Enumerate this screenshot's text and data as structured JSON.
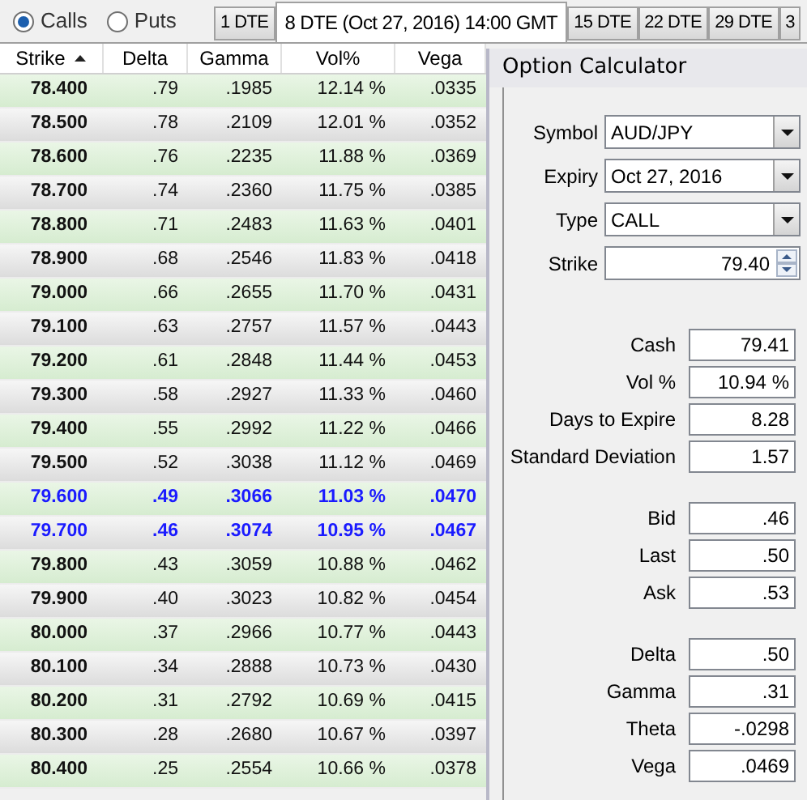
{
  "option_type": [
    {
      "label": "Calls",
      "selected": true
    },
    {
      "label": "Puts",
      "selected": false
    }
  ],
  "tabs": [
    {
      "label": "1 DTE",
      "selected": false
    },
    {
      "label": "8 DTE (Oct 27, 2016) 14:00 GMT",
      "selected": true
    },
    {
      "label": "15 DTE",
      "selected": false
    },
    {
      "label": "22 DTE",
      "selected": false
    },
    {
      "label": "29 DTE",
      "selected": false
    },
    {
      "label": "3",
      "selected": false
    }
  ],
  "table": {
    "columns": [
      "Strike",
      "Delta",
      "Gamma",
      "Vol%",
      "Vega"
    ],
    "rows": [
      {
        "cells": [
          "78.400",
          ".79",
          ".1985",
          "12.14 %",
          ".0335"
        ],
        "highlighted": false
      },
      {
        "cells": [
          "78.500",
          ".78",
          ".2109",
          "12.01 %",
          ".0352"
        ],
        "highlighted": false
      },
      {
        "cells": [
          "78.600",
          ".76",
          ".2235",
          "11.88 %",
          ".0369"
        ],
        "highlighted": false
      },
      {
        "cells": [
          "78.700",
          ".74",
          ".2360",
          "11.75 %",
          ".0385"
        ],
        "highlighted": false
      },
      {
        "cells": [
          "78.800",
          ".71",
          ".2483",
          "11.63 %",
          ".0401"
        ],
        "highlighted": false
      },
      {
        "cells": [
          "78.900",
          ".68",
          ".2546",
          "11.83 %",
          ".0418"
        ],
        "highlighted": false
      },
      {
        "cells": [
          "79.000",
          ".66",
          ".2655",
          "11.70 %",
          ".0431"
        ],
        "highlighted": false
      },
      {
        "cells": [
          "79.100",
          ".63",
          ".2757",
          "11.57 %",
          ".0443"
        ],
        "highlighted": false
      },
      {
        "cells": [
          "79.200",
          ".61",
          ".2848",
          "11.44 %",
          ".0453"
        ],
        "highlighted": false
      },
      {
        "cells": [
          "79.300",
          ".58",
          ".2927",
          "11.33 %",
          ".0460"
        ],
        "highlighted": false
      },
      {
        "cells": [
          "79.400",
          ".55",
          ".2992",
          "11.22 %",
          ".0466"
        ],
        "highlighted": false
      },
      {
        "cells": [
          "79.500",
          ".52",
          ".3038",
          "11.12 %",
          ".0469"
        ],
        "highlighted": false
      },
      {
        "cells": [
          "79.600",
          ".49",
          ".3066",
          "11.03 %",
          ".0470"
        ],
        "highlighted": true
      },
      {
        "cells": [
          "79.700",
          ".46",
          ".3074",
          "10.95 %",
          ".0467"
        ],
        "highlighted": true
      },
      {
        "cells": [
          "79.800",
          ".43",
          ".3059",
          "10.88 %",
          ".0462"
        ],
        "highlighted": false
      },
      {
        "cells": [
          "79.900",
          ".40",
          ".3023",
          "10.82 %",
          ".0454"
        ],
        "highlighted": false
      },
      {
        "cells": [
          "80.000",
          ".37",
          ".2966",
          "10.77 %",
          ".0443"
        ],
        "highlighted": false
      },
      {
        "cells": [
          "80.100",
          ".34",
          ".2888",
          "10.73 %",
          ".0430"
        ],
        "highlighted": false
      },
      {
        "cells": [
          "80.200",
          ".31",
          ".2792",
          "10.69 %",
          ".0415"
        ],
        "highlighted": false
      },
      {
        "cells": [
          "80.300",
          ".28",
          ".2680",
          "10.67 %",
          ".0397"
        ],
        "highlighted": false
      },
      {
        "cells": [
          "80.400",
          ".25",
          ".2554",
          "10.66 %",
          ".0378"
        ],
        "highlighted": false
      }
    ]
  },
  "calculator": {
    "title": "Option Calculator",
    "inputs": [
      {
        "label": "Symbol",
        "value": "AUD/JPY",
        "kind": "dropdown"
      },
      {
        "label": "Expiry",
        "value": "Oct 27, 2016",
        "kind": "dropdown"
      },
      {
        "label": "Type",
        "value": "CALL",
        "kind": "dropdown"
      },
      {
        "label": "Strike",
        "value": "79.40",
        "kind": "spinner"
      }
    ],
    "groups": [
      [
        {
          "label": "Cash",
          "value": "79.41"
        },
        {
          "label": "Vol %",
          "value": "10.94 %"
        },
        {
          "label": "Days to Expire",
          "value": "8.28"
        },
        {
          "label": "Standard Deviation",
          "value": "1.57"
        }
      ],
      [
        {
          "label": "Bid",
          "value": ".46"
        },
        {
          "label": "Last",
          "value": ".50"
        },
        {
          "label": "Ask",
          "value": ".53"
        }
      ],
      [
        {
          "label": "Delta",
          "value": ".50"
        },
        {
          "label": "Gamma",
          "value": ".31"
        },
        {
          "label": "Theta",
          "value": "-.0298"
        },
        {
          "label": "Vega",
          "value": ".0469"
        }
      ]
    ]
  }
}
